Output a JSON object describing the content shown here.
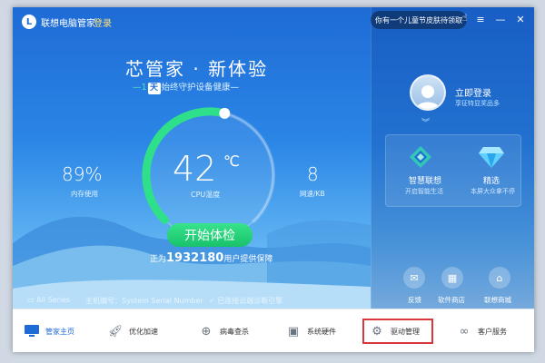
{
  "window": {
    "title": "联想电脑管家",
    "login_link": "登录",
    "promo_text": "你有一个儿童节皮肤待领取",
    "controls": {
      "menu": "≡",
      "minimize": "—",
      "close": "✕"
    }
  },
  "hero": {
    "headline": "芯管家 · 新体验",
    "sub_prefix": "—1",
    "sub_day": "天",
    "sub_text": "始终守护设备健康—"
  },
  "gauge": {
    "temperature": "42",
    "unit": "℃",
    "label": "CPU温度",
    "level_fraction": 0.55
  },
  "stats": {
    "memory_value": "89%",
    "memory_label": "内存使用",
    "network_value": "8",
    "network_label": "网速/KB"
  },
  "start_button": "开始体检",
  "protect": {
    "prefix": "正为",
    "count": "1932180",
    "suffix": "用户提供保障"
  },
  "bottom_info": {
    "series": "All Series",
    "serial": "主机编号：System Serial Number",
    "cloud": "已连接云端诊断引擎"
  },
  "account": {
    "login_now": "立即登录",
    "login_sub": "享征特显奖品多"
  },
  "features": [
    {
      "title": "智慧联想",
      "sub": "开启智能生活"
    },
    {
      "title": "精选",
      "sub": "本屏大众拿不停"
    }
  ],
  "quick_links": [
    {
      "label": "反馈",
      "icon": "feedback-icon"
    },
    {
      "label": "软件商店",
      "icon": "store-icon"
    },
    {
      "label": "联想商城",
      "icon": "shop-icon"
    }
  ],
  "nav": [
    {
      "label": "管家主页",
      "icon": "monitor-icon"
    },
    {
      "label": "优化加速",
      "icon": "rocket-icon"
    },
    {
      "label": "病毒查杀",
      "icon": "shield-plus-icon"
    },
    {
      "label": "系统硬件",
      "icon": "chip-icon"
    },
    {
      "label": "驱动管理",
      "icon": "gear-icon"
    },
    {
      "label": "客户服务",
      "icon": "handshake-icon"
    }
  ],
  "colors": {
    "accent": "#1e6bd6",
    "gauge_green": "#2fe08a",
    "highlight_red": "#d9363e"
  }
}
